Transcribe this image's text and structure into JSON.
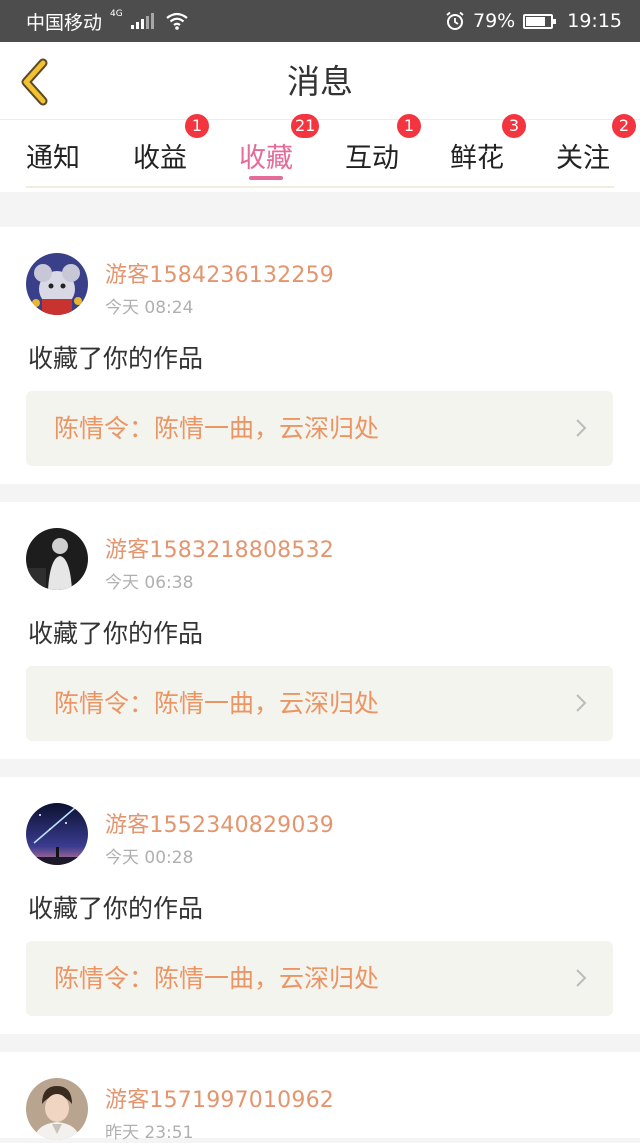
{
  "status_bar": {
    "carrier": "中国移动",
    "network": "4G",
    "battery": "79%",
    "battery_level": 0.79,
    "time": "19:15"
  },
  "header": {
    "title": "消息"
  },
  "tabs": [
    {
      "label": "通知",
      "badge": ""
    },
    {
      "label": "收益",
      "badge": "1"
    },
    {
      "label": "收藏",
      "badge": "21",
      "active": true
    },
    {
      "label": "互动",
      "badge": "1"
    },
    {
      "label": "鲜花",
      "badge": "3"
    },
    {
      "label": "关注",
      "badge": "2"
    }
  ],
  "colors": {
    "accent": "#e56b9a",
    "badge": "#f2353f",
    "username": "#e4956e",
    "work_title": "#ec9564"
  },
  "messages": [
    {
      "user": "游客1584236132259",
      "time": "今天 08:24",
      "action": "收藏了你的作品",
      "work": "陈情令：陈情一曲，云深归处",
      "avatar": "cartoon-mouse-avatar"
    },
    {
      "user": "游客1583218808532",
      "time": "今天 06:38",
      "action": "收藏了你的作品",
      "work": "陈情令：陈情一曲，云深归处",
      "avatar": "dark-figure-avatar"
    },
    {
      "user": "游客1552340829039",
      "time": "今天 00:28",
      "action": "收藏了你的作品",
      "work": "陈情令：陈情一曲，云深归处",
      "avatar": "night-sky-avatar"
    },
    {
      "user": "游客1571997010962",
      "time": "昨天 23:51",
      "action": "",
      "work": "",
      "avatar": "portrait-avatar"
    }
  ]
}
